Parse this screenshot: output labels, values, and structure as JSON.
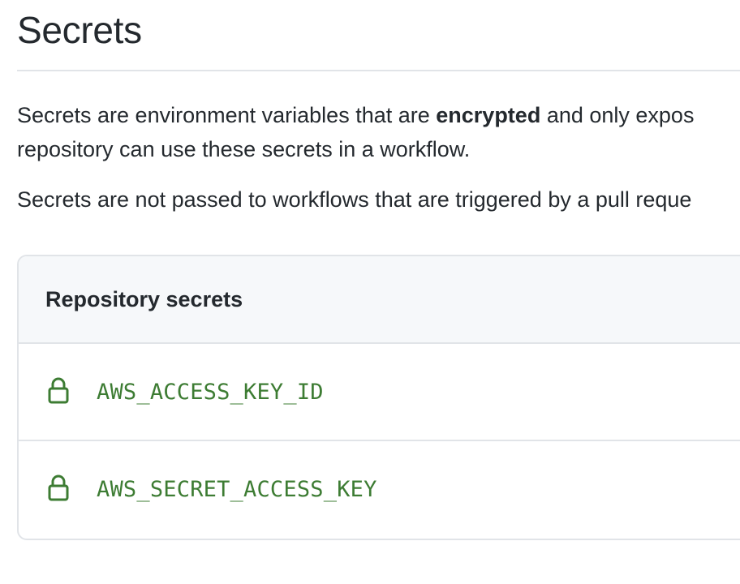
{
  "page": {
    "title": "Secrets"
  },
  "description": {
    "para1_start": "Secrets are environment variables that are ",
    "para1_bold": "encrypted",
    "para1_end": " and only expos",
    "para1_line2": "repository can use these secrets in a workflow.",
    "para2": "Secrets are not passed to workflows that are triggered by a pull reque"
  },
  "repository_secrets": {
    "heading": "Repository secrets",
    "items": [
      {
        "name": "AWS_ACCESS_KEY_ID",
        "icon": "lock-icon"
      },
      {
        "name": "AWS_SECRET_ACCESS_KEY",
        "icon": "lock-icon"
      }
    ]
  },
  "colors": {
    "secret_name": "#3d7c33",
    "lock_icon": "#3d7c33",
    "header_bg": "#f6f8fa",
    "border": "#e1e4e8",
    "text": "#24292e"
  }
}
